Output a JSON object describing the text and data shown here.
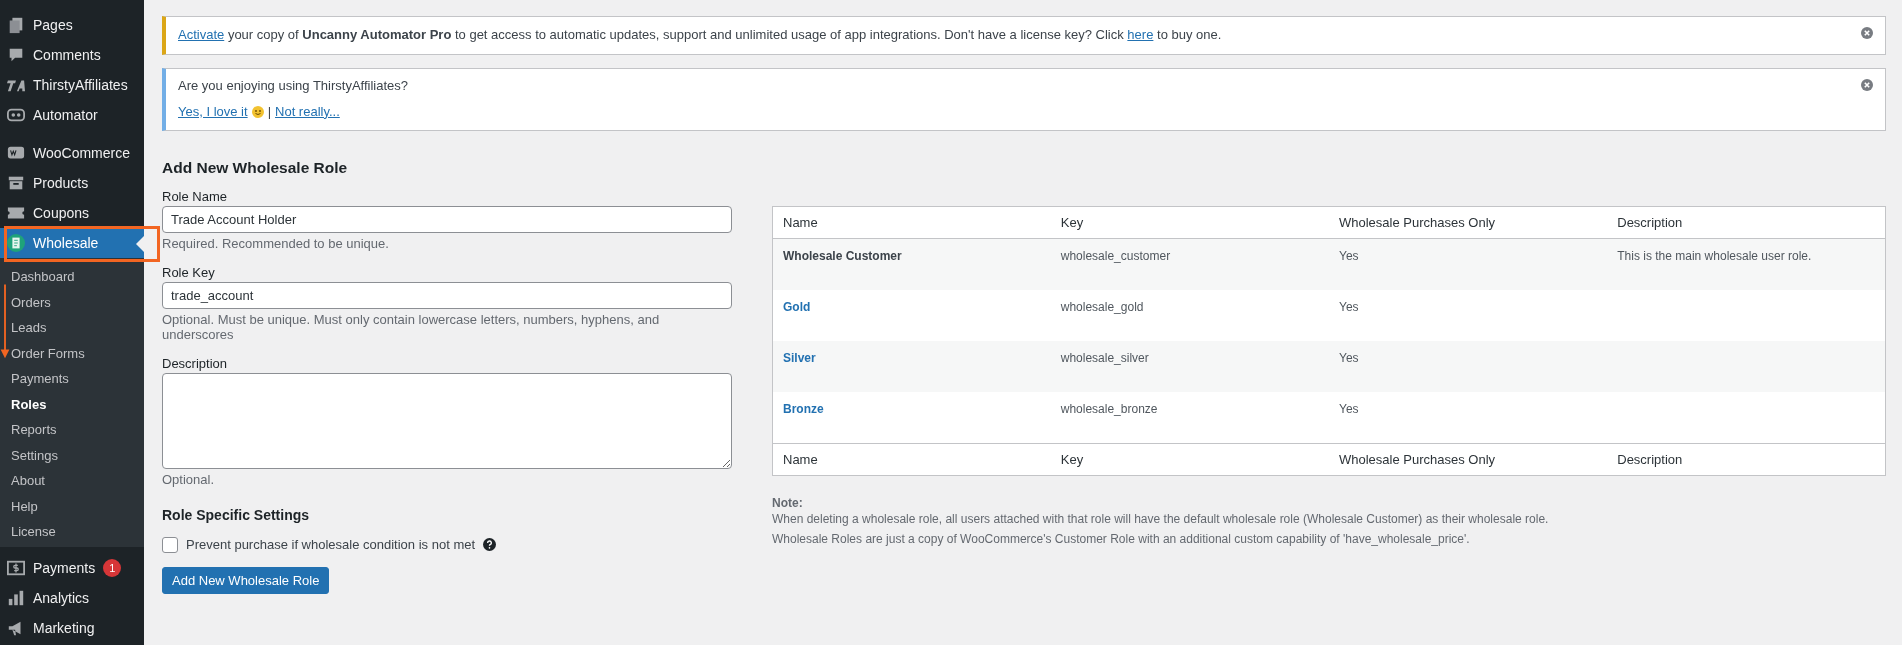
{
  "sidebar": {
    "groups": [
      {
        "items": [
          {
            "label": "Pages",
            "selected": false
          },
          {
            "label": "Comments",
            "selected": false
          },
          {
            "label": "ThirstyAffiliates",
            "selected": false
          },
          {
            "label": "Automator",
            "selected": false
          }
        ]
      },
      {
        "items": [
          {
            "label": "WooCommerce",
            "selected": false
          },
          {
            "label": "Products",
            "selected": false
          },
          {
            "label": "Coupons",
            "selected": false
          },
          {
            "label": "Wholesale",
            "selected": true,
            "children": [
              {
                "label": "Dashboard",
                "selected": false
              },
              {
                "label": "Orders",
                "selected": false
              },
              {
                "label": "Leads",
                "selected": false
              },
              {
                "label": "Order Forms",
                "selected": false
              },
              {
                "label": "Payments",
                "selected": false
              },
              {
                "label": "Roles",
                "selected": true
              },
              {
                "label": "Reports",
                "selected": false
              },
              {
                "label": "Settings",
                "selected": false
              },
              {
                "label": "About",
                "selected": false
              },
              {
                "label": "Help",
                "selected": false
              },
              {
                "label": "License",
                "selected": false
              }
            ]
          }
        ]
      },
      {
        "items": [
          {
            "label": "Payments",
            "selected": false,
            "badge": "1"
          },
          {
            "label": "Analytics",
            "selected": false
          },
          {
            "label": "Marketing",
            "selected": false
          }
        ]
      }
    ]
  },
  "notices": [
    {
      "kind": "warning",
      "parts": [
        {
          "kind": "link",
          "text": "Activate"
        },
        {
          "kind": "text",
          "text": "your copy of **Uncanny Automator Pro** to get access to automatic updates, support and unlimited usage of app integrations. Don't have a license key? Click"
        },
        {
          "kind": "link",
          "text": "here"
        },
        {
          "kind": "text",
          "text": "to buy one."
        }
      ]
    },
    {
      "kind": "info",
      "question": "Are you enjoying using ThirstyAffiliates?",
      "links": [
        "Yes, I love it",
        "Not really..."
      ],
      "separator": "|"
    }
  ],
  "form": {
    "title": "Add New Wholesale Role",
    "fields": [
      {
        "kind": "input",
        "label": "Role Name",
        "value": "Trade Account Holder",
        "hint": "Required. Recommended to be unique."
      },
      {
        "kind": "input",
        "label": "Role Key",
        "value": "trade_account",
        "hint": "Optional. Must be unique. Must only contain lowercase letters, numbers, hyphens, and underscores"
      },
      {
        "kind": "textarea",
        "label": "Description",
        "hint": "Optional."
      }
    ],
    "settings_title": "Role Specific Settings",
    "checkbox": {
      "label": "Prevent purchase if wholesale condition is not met",
      "checked": false
    },
    "submit": "Add New Wholesale Role"
  },
  "table": {
    "columns": [
      "Name",
      "Key",
      "Wholesale Purchases Only",
      "Description"
    ],
    "rows": [
      {
        "name": "Wholesale Customer",
        "linked": false,
        "key": "wholesale_customer",
        "purchases_only": "Yes",
        "description": "This is the main wholesale user role."
      },
      {
        "name": "Gold",
        "linked": true,
        "key": "wholesale_gold",
        "purchases_only": "Yes"
      },
      {
        "name": "Silver",
        "linked": true,
        "key": "wholesale_silver",
        "purchases_only": "Yes"
      },
      {
        "name": "Bronze",
        "linked": true,
        "key": "wholesale_bronze",
        "purchases_only": "Yes"
      }
    ],
    "footer_columns": [
      "Name",
      "Key",
      "Wholesale Purchases Only",
      "Description"
    ]
  },
  "note": {
    "title": "Note:",
    "lines": [
      "When deleting a wholesale role, all users attached with that role will have the default wholesale role (Wholesale Customer) as their wholesale role.",
      "Wholesale Roles are just a copy of WooCommerce's Customer Role with an additional custom capability of 'have_wholesale_price'."
    ]
  }
}
